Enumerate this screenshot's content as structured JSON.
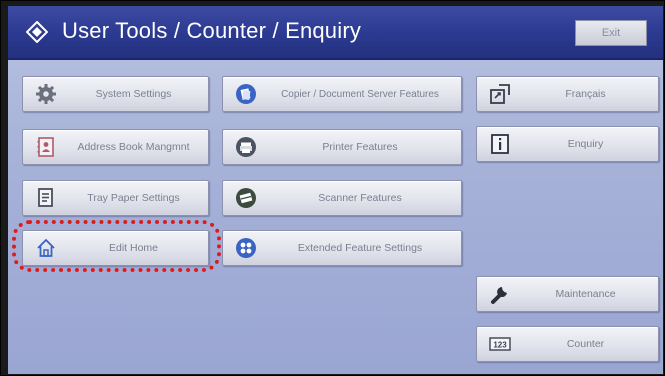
{
  "header": {
    "title": "User Tools / Counter / Enquiry",
    "exit_label": "Exit",
    "icon": "diamond-arrows-icon"
  },
  "buttons": {
    "system_settings": {
      "label": "System Settings",
      "icon": "gear-icon"
    },
    "address_book": {
      "label": "Address Book Mangmnt",
      "icon": "address-book-icon"
    },
    "tray_paper": {
      "label": "Tray Paper Settings",
      "icon": "tray-paper-icon"
    },
    "edit_home": {
      "label": "Edit Home",
      "icon": "home-icon"
    },
    "copier_features": {
      "label": "Copier / Document Server Features",
      "icon": "copier-icon"
    },
    "printer_features": {
      "label": "Printer Features",
      "icon": "printer-icon"
    },
    "scanner_features": {
      "label": "Scanner Features",
      "icon": "scanner-icon"
    },
    "extended_features": {
      "label": "Extended Feature Settings",
      "icon": "extended-features-icon"
    },
    "language": {
      "label": "Français",
      "icon": "language-switch-icon"
    },
    "enquiry": {
      "label": "Enquiry",
      "icon": "info-icon"
    },
    "maintenance": {
      "label": "Maintenance",
      "icon": "wrench-icon"
    },
    "counter": {
      "label": "Counter",
      "icon": "counter-123-icon"
    }
  },
  "colors": {
    "header": "#2b3990",
    "background": "#a7b2d9",
    "highlight": "#e01b1b",
    "icon_blue": "#3a64c4"
  }
}
